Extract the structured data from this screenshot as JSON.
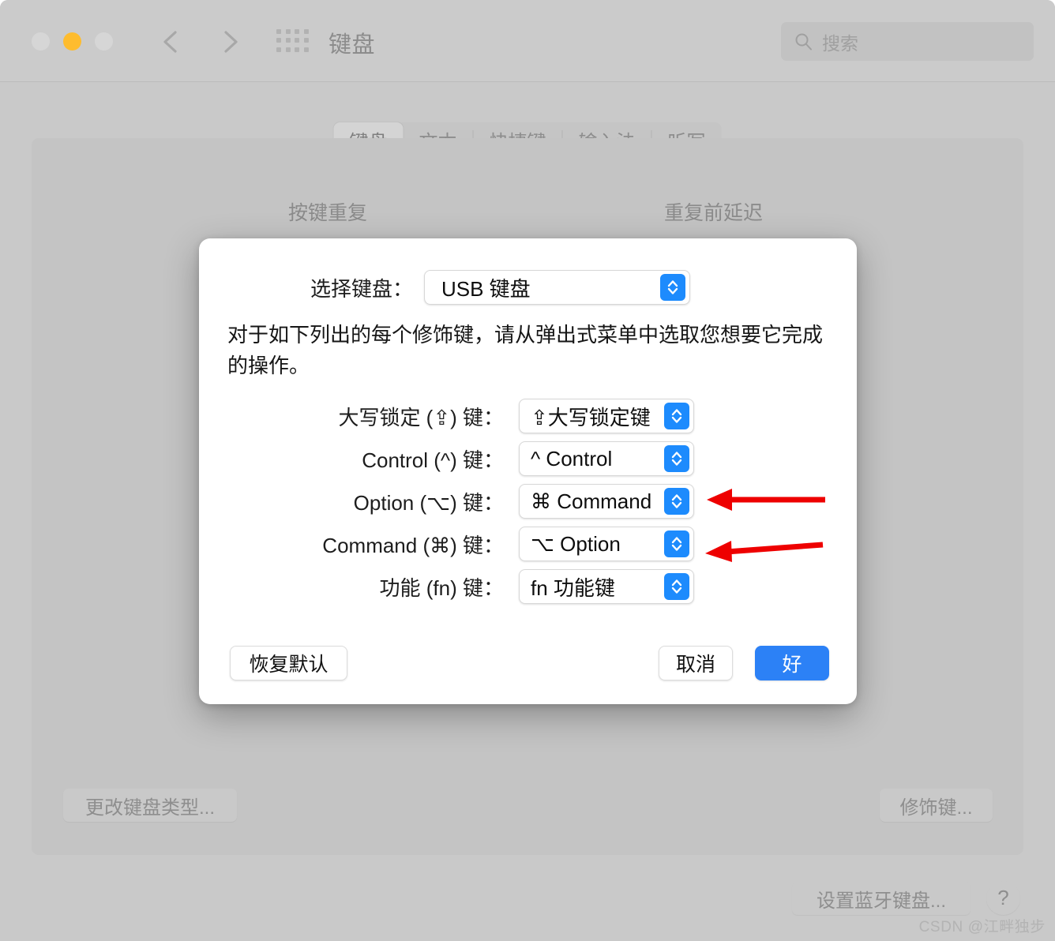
{
  "window": {
    "title": "键盘",
    "traffic_lights": [
      "close",
      "minimize",
      "zoom"
    ],
    "accent_blue": "#1d8bfd",
    "default_button_blue": "#2c81f6",
    "annotation_red": "#ee0000"
  },
  "search": {
    "placeholder": "搜索",
    "icon": "search-icon"
  },
  "nav": {
    "back_icon": "chevron-left-icon",
    "forward_icon": "chevron-right-icon",
    "grid_icon": "grid-dots-icon"
  },
  "tabs": [
    {
      "label": "键盘",
      "selected": true
    },
    {
      "label": "文本",
      "selected": false
    },
    {
      "label": "快捷键",
      "selected": false
    },
    {
      "label": "输入法",
      "selected": false
    },
    {
      "label": "听写",
      "selected": false
    }
  ],
  "background_panel": {
    "heading_repeat": "按键重复",
    "heading_delay": "重复前延迟",
    "buttons": {
      "change_keyboard_type": "更改键盘类型...",
      "modifier_keys": "修饰键...",
      "setup_bluetooth_keyboard": "设置蓝牙键盘...",
      "help": "?"
    }
  },
  "dialog": {
    "chooser_label": "选择键盘：",
    "chooser_value": "USB 键盘",
    "description": "对于如下列出的每个修饰键，请从弹出式菜单中选取您想要它完成的操作。",
    "modifier_rows": [
      {
        "label": "大写锁定 (⇪) 键：",
        "value": "⇪大写锁定键",
        "annotated": false
      },
      {
        "label": "Control (^) 键：",
        "value": "^ Control",
        "annotated": false
      },
      {
        "label": "Option (⌥) 键：",
        "value": "⌘ Command",
        "annotated": true
      },
      {
        "label": "Command (⌘) 键：",
        "value": "⌥ Option",
        "annotated": true
      },
      {
        "label": "功能 (fn) 键：",
        "value": "fn 功能键",
        "annotated": false
      }
    ],
    "buttons": {
      "restore_defaults": "恢复默认",
      "cancel": "取消",
      "ok": "好"
    }
  },
  "watermark": "CSDN @江畔独步"
}
